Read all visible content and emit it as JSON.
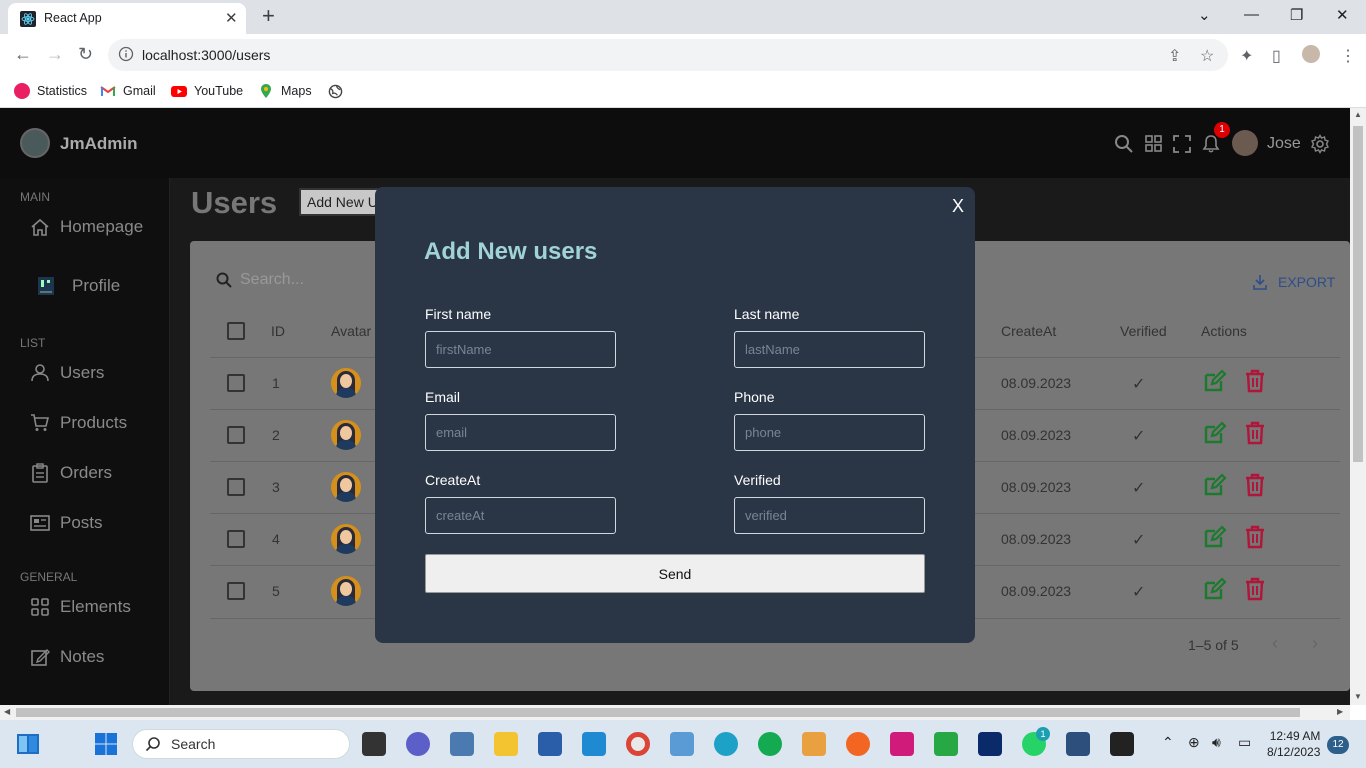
{
  "browser": {
    "tab_title": "React App",
    "url": "localhost:3000/users",
    "bookmarks": [
      {
        "label": "Statistics",
        "color": "#e91e63"
      },
      {
        "label": "Gmail",
        "color": "#ea4335"
      },
      {
        "label": "YouTube",
        "color": "#ff0000"
      },
      {
        "label": "Maps",
        "color": "#34a853"
      }
    ]
  },
  "app": {
    "logo": "JmAdmin",
    "user_name": "Jose",
    "notification_count": "1",
    "sidebar": {
      "sections": [
        {
          "title": "MAIN",
          "items": [
            "Homepage",
            "Profile"
          ]
        },
        {
          "title": "LIST",
          "items": [
            "Users",
            "Products",
            "Orders",
            "Posts"
          ]
        },
        {
          "title": "GENERAL",
          "items": [
            "Elements",
            "Notes"
          ]
        }
      ]
    },
    "page_title": "Users",
    "add_button": "Add New Users",
    "search_placeholder": "Search...",
    "export_label": "EXPORT",
    "columns": [
      "ID",
      "Avatar",
      "CreateAt",
      "Verified",
      "Actions"
    ],
    "rows": [
      {
        "id": "1",
        "createAt": "08.09.2023",
        "verified": "✓"
      },
      {
        "id": "2",
        "createAt": "08.09.2023",
        "verified": "✓"
      },
      {
        "id": "3",
        "createAt": "08.09.2023",
        "verified": "✓"
      },
      {
        "id": "4",
        "createAt": "08.09.2023",
        "verified": "✓"
      },
      {
        "id": "5",
        "createAt": "08.09.2023",
        "verified": "✓"
      }
    ],
    "pagination": "1–5 of 5"
  },
  "modal": {
    "close": "X",
    "title": "Add New users",
    "fields": {
      "first_name": {
        "label": "First name",
        "placeholder": "firstName"
      },
      "last_name": {
        "label": "Last name",
        "placeholder": "lastName"
      },
      "email": {
        "label": "Email",
        "placeholder": "email"
      },
      "phone": {
        "label": "Phone",
        "placeholder": "phone"
      },
      "create_at": {
        "label": "CreateAt",
        "placeholder": "createAt"
      },
      "verified": {
        "label": "Verified",
        "placeholder": "verified"
      }
    },
    "send": "Send"
  },
  "taskbar": {
    "search": "Search",
    "time": "12:49 AM",
    "date": "8/12/2023",
    "notifications": "12",
    "whatsapp_badge": "1"
  },
  "colors": {
    "accent_title": "#9fd3d6",
    "modal_bg": "#2a3546",
    "edit_green": "#1b7a2e",
    "delete_red": "#b0163a"
  }
}
